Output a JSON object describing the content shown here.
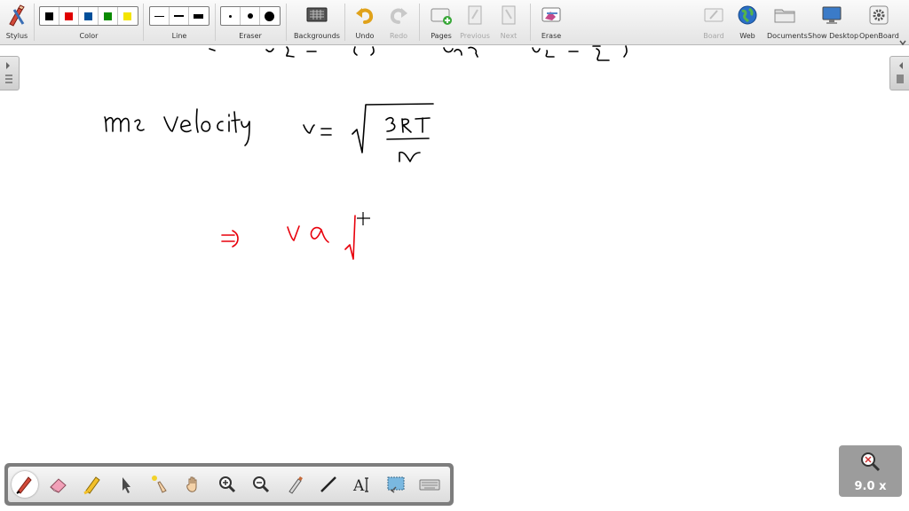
{
  "toolbar": {
    "stylus_label": "Stylus",
    "color_label": "Color",
    "line_label": "Line",
    "eraser_label": "Eraser",
    "backgrounds_label": "Backgrounds",
    "undo_label": "Undo",
    "redo_label": "Redo",
    "pages_label": "Pages",
    "previous_label": "Previous",
    "next_label": "Next",
    "erase_label": "Erase",
    "board_label": "Board",
    "web_label": "Web",
    "documents_label": "Documents",
    "show_desktop_label": "Show Desktop",
    "openboard_label": "OpenBoard",
    "colors": [
      "#000000",
      "#e00000",
      "#004f9a",
      "#0a8a00",
      "#f4e400"
    ]
  },
  "zoom": {
    "value": "9.0 x"
  },
  "colors": {
    "ink_black": "#000000",
    "ink_red": "#e8000b"
  },
  "dock_tools": [
    "pen-tool",
    "eraser-tool",
    "highlighter-tool",
    "selector-tool",
    "laser-pointer-tool",
    "hand-tool",
    "zoom-in-tool",
    "zoom-out-tool",
    "pointer-pen-tool",
    "line-tool",
    "text-tool",
    "capture-tool",
    "keyboard-tool"
  ]
}
